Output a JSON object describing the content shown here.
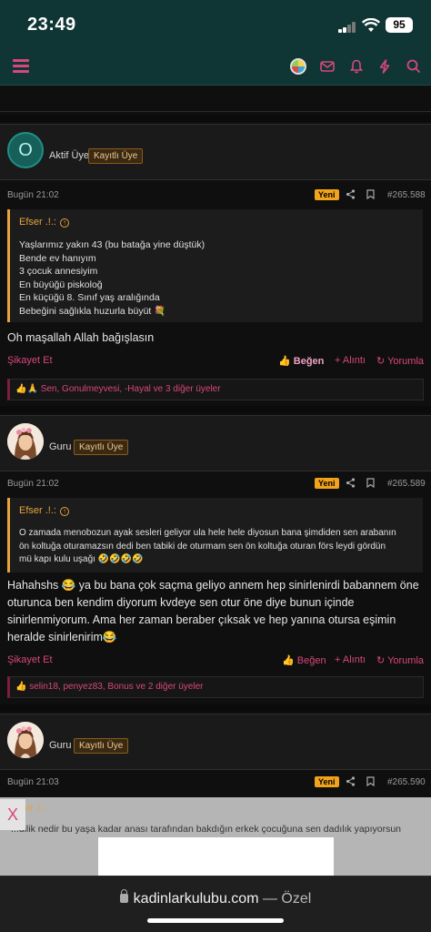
{
  "status_bar": {
    "time": "23:49",
    "battery": "95"
  },
  "nav": {
    "icons": [
      "menu-icon",
      "avatar",
      "mail-icon",
      "bell-icon",
      "bolt-icon",
      "search-icon"
    ]
  },
  "posts": [
    {
      "username": "",
      "avatar_letter": "O",
      "role": "Aktif Üye",
      "badge": "Kayıtlı Üye",
      "date": "Bugün 21:02",
      "new_label": "Yeni",
      "post_no": "#265.588",
      "quote_author": "Efser .!.:",
      "quote_lines": "Yaşlarımız yakın 43 (bu batağa yine düştük)\nBende ev hanıyım\n3 çocuk annesiyim\nEn büyüğü piskoloğ\nEn küçüğü 8. Sınıf yaş aralığında\nBebeğini sağlıkla huzurla büyüt 💐",
      "message": "Oh maşallah Allah bağışlasın",
      "report": "Şikayet Et",
      "like": "Beğen",
      "quote_btn": "+ Alıntı",
      "reply": "Yorumla",
      "reactions_emoji": "👍🙏",
      "reactions": "Sen, Gonulmeyvesi, -Hayal ve 3 diğer üyeler"
    },
    {
      "username": "",
      "role": "Guru",
      "badge": "Kayıtlı Üye",
      "date": "Bugün 21:02",
      "new_label": "Yeni",
      "post_no": "#265.589",
      "quote_author": "Efser .!.:",
      "quote_lines": "O zamada menobozun ayak sesleri geliyor ula hele hele diyosun bana şimdiden sen arabanın\nön koltuğa oturamazsın dedi ben tabiki de oturmam sen ön koltuğa oturan förs leydi gördün\nmü kapı kulu uşağı 🤣🤣🤣🤣",
      "message": "Hahahshs 😂 ya bu bana çok saçma geliyo annem hep sinirlenirdi babannem öne oturunca ben kendim diyorum kvdeye sen otur öne diye bunun içinde sinirlenmiyorum. Ama her zaman beraber çıksak ve hep yanına otursa eşimin heralde sinirlenirim😂",
      "report": "Şikayet Et",
      "like": "Beğen",
      "quote_btn": "+ Alıntı",
      "reply": "Yorumla",
      "reactions_emoji": "👍",
      "reactions": "selin18, penyez83, Bonus ve 2 diğer üyeler"
    },
    {
      "username": "",
      "role": "Guru",
      "badge": "Kayıtlı Üye",
      "date": "Bugün 21:03",
      "new_label": "Yeni",
      "post_no": "#265.590",
      "quote_author": "Efser .!.:",
      "quote_partial": "...dilik nedir bu yaşa kadar anası tarafından bakdığın erkek çocuğuna sen dadılık yapıyorsun"
    }
  ],
  "ad": {
    "close": "X"
  },
  "browser": {
    "domain": "kadinlarkulubu.com",
    "mode": "— Özel"
  }
}
